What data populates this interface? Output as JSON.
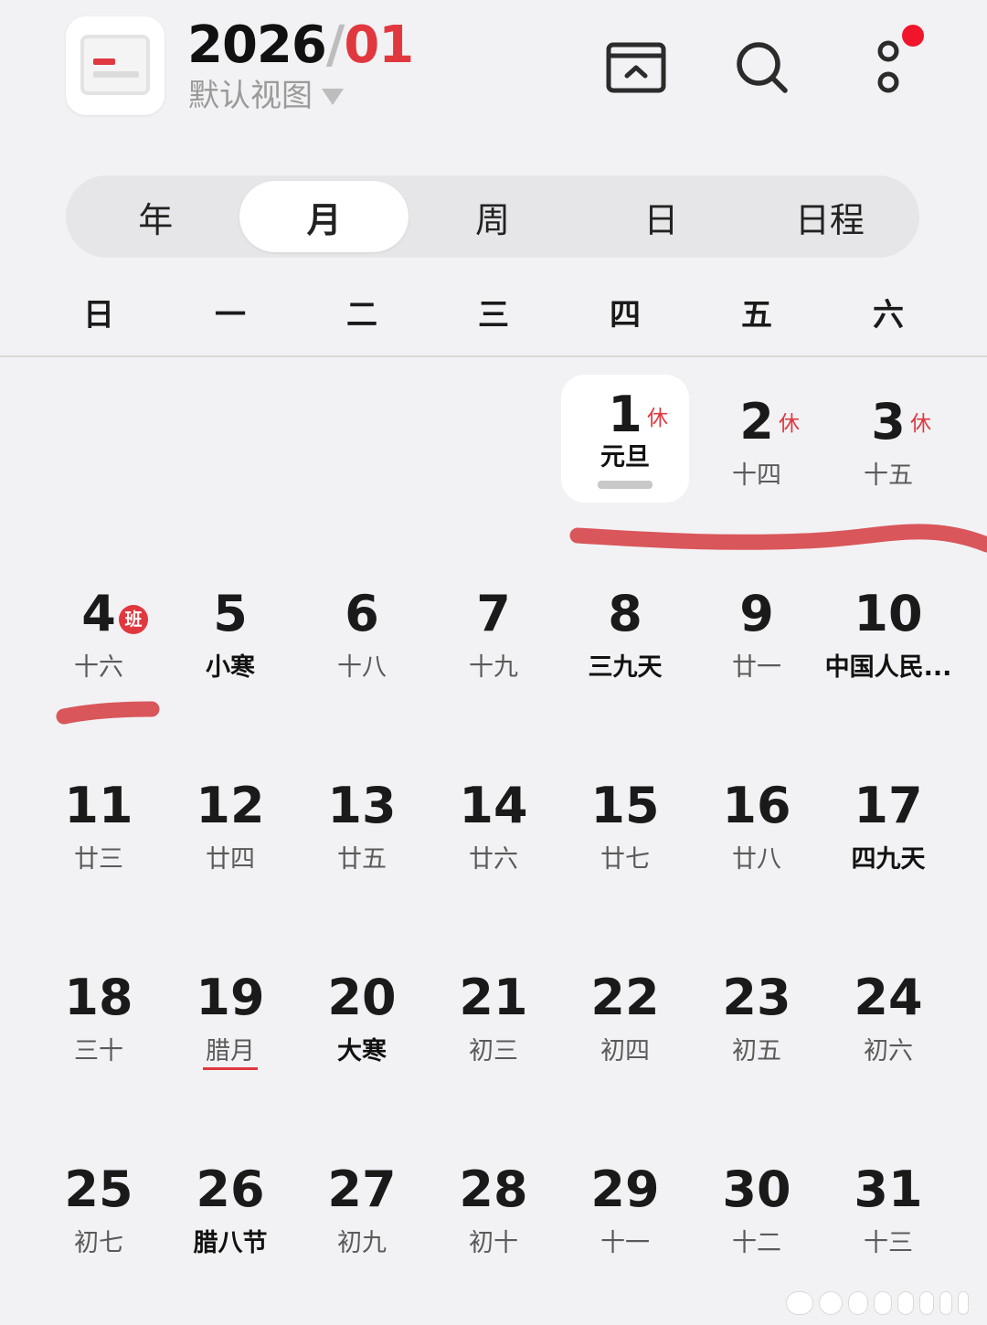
{
  "header": {
    "year": "2026",
    "slash": "/",
    "month": "01",
    "view_label": "默认视图",
    "icons": [
      "app-calendar-icon",
      "collapse-icon",
      "search-icon",
      "more-icon"
    ],
    "badge_color": "#f1152c"
  },
  "tabs": [
    {
      "label": "年",
      "active": false
    },
    {
      "label": "月",
      "active": true
    },
    {
      "label": "周",
      "active": false
    },
    {
      "label": "日",
      "active": false
    },
    {
      "label": "日程",
      "active": false
    }
  ],
  "weekdays": [
    "日",
    "一",
    "二",
    "三",
    "四",
    "五",
    "六"
  ],
  "colors": {
    "accent": "#e0383e",
    "background": "#f2f2f4"
  },
  "weeks": [
    [
      null,
      null,
      null,
      null,
      {
        "day": "1",
        "sub": "元旦",
        "badge": "休",
        "badge_type": "rest",
        "selected": true
      },
      {
        "day": "2",
        "sub": "十四",
        "badge": "休",
        "badge_type": "rest"
      },
      {
        "day": "3",
        "sub": "十五",
        "badge": "休",
        "badge_type": "rest"
      }
    ],
    [
      {
        "day": "4",
        "sub": "十六",
        "badge": "班",
        "badge_type": "work"
      },
      {
        "day": "5",
        "sub": "小寒",
        "bold": true
      },
      {
        "day": "6",
        "sub": "十八"
      },
      {
        "day": "7",
        "sub": "十九"
      },
      {
        "day": "8",
        "sub": "三九天",
        "bold": true
      },
      {
        "day": "9",
        "sub": "廿一"
      },
      {
        "day": "10",
        "sub": "中国人民...",
        "bold": true
      }
    ],
    [
      {
        "day": "11",
        "sub": "廿三"
      },
      {
        "day": "12",
        "sub": "廿四"
      },
      {
        "day": "13",
        "sub": "廿五"
      },
      {
        "day": "14",
        "sub": "廿六"
      },
      {
        "day": "15",
        "sub": "廿七"
      },
      {
        "day": "16",
        "sub": "廿八"
      },
      {
        "day": "17",
        "sub": "四九天",
        "bold": true
      }
    ],
    [
      {
        "day": "18",
        "sub": "三十"
      },
      {
        "day": "19",
        "sub": "腊月",
        "underline": true
      },
      {
        "day": "20",
        "sub": "大寒",
        "bold": true
      },
      {
        "day": "21",
        "sub": "初三"
      },
      {
        "day": "22",
        "sub": "初四"
      },
      {
        "day": "23",
        "sub": "初五"
      },
      {
        "day": "24",
        "sub": "初六"
      }
    ],
    [
      {
        "day": "25",
        "sub": "初七"
      },
      {
        "day": "26",
        "sub": "腊八节",
        "bold": true
      },
      {
        "day": "27",
        "sub": "初九"
      },
      {
        "day": "28",
        "sub": "初十"
      },
      {
        "day": "29",
        "sub": "十一"
      },
      {
        "day": "30",
        "sub": "十二"
      },
      {
        "day": "31",
        "sub": "十三"
      }
    ]
  ]
}
